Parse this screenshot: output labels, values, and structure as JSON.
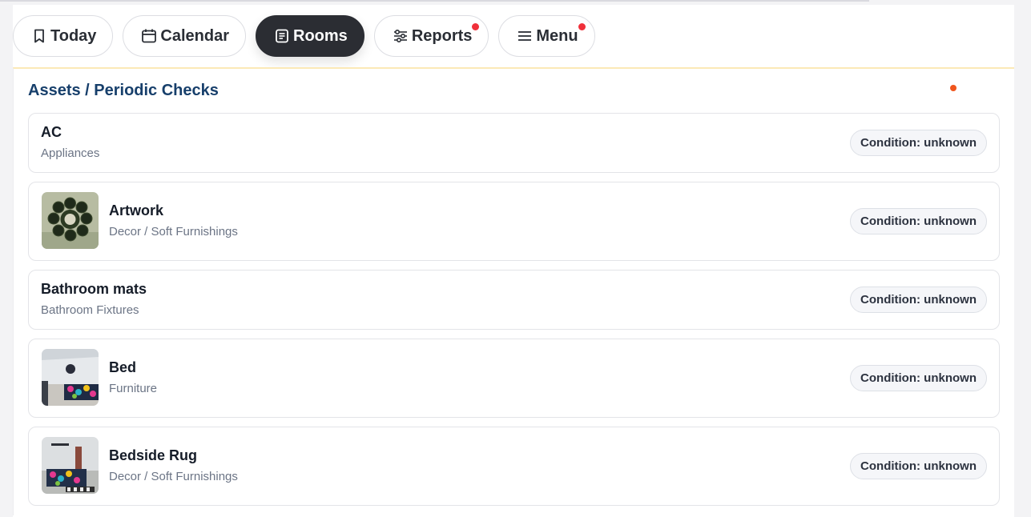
{
  "nav": {
    "tabs": [
      {
        "label": "Today",
        "icon": "bookmark-icon",
        "active": false,
        "notify": false
      },
      {
        "label": "Calendar",
        "icon": "calendar-icon",
        "active": false,
        "notify": false
      },
      {
        "label": "Rooms",
        "icon": "document-icon",
        "active": true,
        "notify": false
      },
      {
        "label": "Reports",
        "icon": "sliders-icon",
        "active": false,
        "notify": true
      },
      {
        "label": "Menu",
        "icon": "hamburger-icon",
        "active": false,
        "notify": true
      }
    ]
  },
  "panel": {
    "title": "Assets / Periodic Checks",
    "items": [
      {
        "name": "AC",
        "category": "Appliances",
        "condition": "Condition: unknown",
        "thumbnail": null
      },
      {
        "name": "Artwork",
        "category": "Decor / Soft Furnishings",
        "condition": "Condition: unknown",
        "thumbnail": "wreath-photo"
      },
      {
        "name": "Bathroom mats",
        "category": "Bathroom Fixtures",
        "condition": "Condition: unknown",
        "thumbnail": null
      },
      {
        "name": "Bed",
        "category": "Furniture",
        "condition": "Condition: unknown",
        "thumbnail": "bedroom-photo"
      },
      {
        "name": "Bedside Rug",
        "category": "Decor / Soft Furnishings",
        "condition": "Condition: unknown",
        "thumbnail": "bedroom-rug-photo"
      }
    ]
  },
  "colors": {
    "title": "#173f6b",
    "active_tab": "#2b2d33",
    "notify_dot": "#f0303a",
    "panel_dot": "#f0551c"
  }
}
